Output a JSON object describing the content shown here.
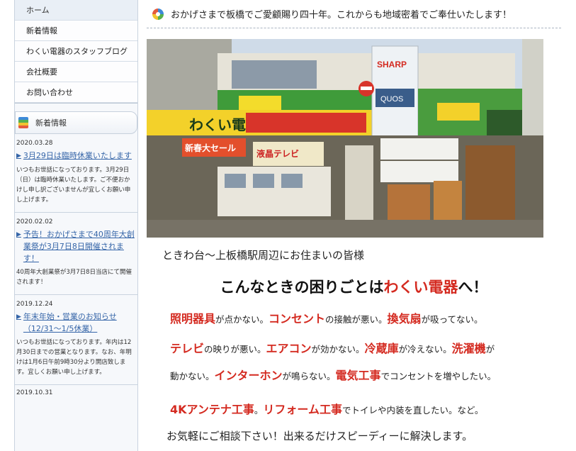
{
  "sidebar": {
    "nav": [
      {
        "label": "ホーム"
      },
      {
        "label": "新着情報"
      },
      {
        "label": "わくい電器のスタッフブログ"
      },
      {
        "label": "会社概要"
      },
      {
        "label": "お問い合わせ"
      }
    ],
    "news_title": "新着情報",
    "news": [
      {
        "date": "2020.03.28",
        "title": "3月29日は臨時休業いたします",
        "excerpt": "いつもお世話になっております。3月29日（日）は臨時休業いたします。ご不便おかけし申し訳ございませんが宜しくお願い申し上げます。"
      },
      {
        "date": "2020.02.02",
        "title": "予告！おかげさまで40周年大創業祭が3月7日8日開催されます！",
        "excerpt": "40周年大創業祭が3月7日8日当店にて開催されます！"
      },
      {
        "date": "2019.12.24",
        "title": "年末年始・営業のお知らせ（12/31〜1/5休業）",
        "excerpt": "いつもお世話になっております。年内は12月30日までの営業となります。なお、年明けは1月6日午前9時30分より開店致します。宜しくお願い申し上げます。"
      },
      {
        "date": "2019.10.31"
      }
    ]
  },
  "main": {
    "tagline": "おかげさまで板橋でご愛顧賜り四十年。これからも地域密着でご奉仕いたします！",
    "photo_signs": {
      "sharp": "SHARP",
      "quos": "QUOS",
      "store_name": "わくい電器",
      "sale": "新春大セール",
      "tv": "液晶テレビ"
    },
    "lead": "ときわ台〜上板橋駅周辺にお住まいの皆様",
    "headline_pre": "こんなときの困りごとは",
    "headline_red": "わくい電器",
    "headline_post": "へ！",
    "troubles": [
      [
        {
          "r": "照明器具"
        },
        {
          "t": "が点かない。"
        },
        {
          "r": "コンセント"
        },
        {
          "t": "の接触が悪い。"
        },
        {
          "r": "換気扇"
        },
        {
          "t": "が吸ってない。"
        }
      ],
      [
        {
          "r": "テレビ"
        },
        {
          "t": "の映りが悪い。"
        },
        {
          "r": "エアコン"
        },
        {
          "t": "が効かない。"
        },
        {
          "r": "冷蔵庫"
        },
        {
          "t": "が冷えない。"
        },
        {
          "r": "洗濯機"
        },
        {
          "t": "が"
        }
      ],
      [
        {
          "t": "動かない。"
        },
        {
          "r": "インターホン"
        },
        {
          "t": "が鳴らない。"
        },
        {
          "r": "電気工事"
        },
        {
          "t": "でコンセントを増やしたい。"
        }
      ],
      [
        {
          "r": "4Kアンテナ工事"
        },
        {
          "t": "。"
        },
        {
          "r": "リフォーム工事"
        },
        {
          "t": "でトイレや内装を直したい。など。"
        }
      ]
    ],
    "closing": "お気軽にご相談下さい！出来るだけスピーディーに解決します。"
  }
}
